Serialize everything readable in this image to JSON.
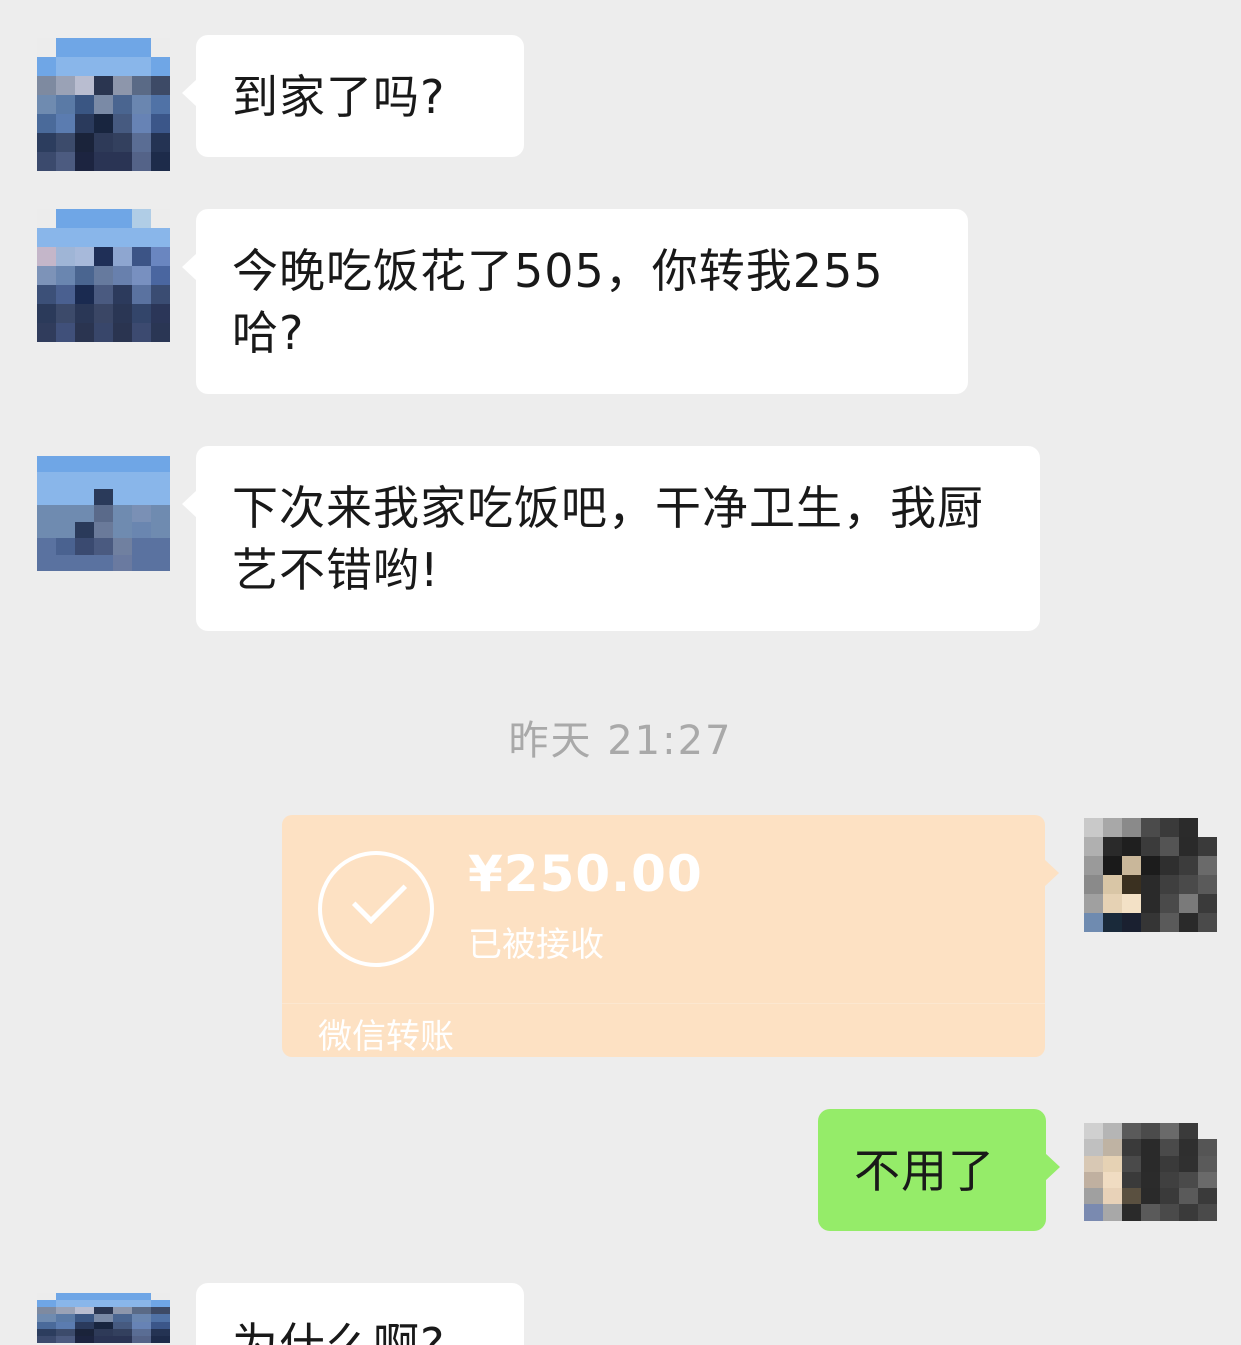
{
  "messages": [
    {
      "side": "left",
      "text": "到家了吗?"
    },
    {
      "side": "left",
      "text": "今晚吃饭花了505，你转我255哈?"
    },
    {
      "side": "left",
      "text": "下次来我家吃饭吧，干净卫生，我厨艺不错哟!"
    }
  ],
  "timestamp": "昨天 21:27",
  "transfer": {
    "amount": "¥250.00",
    "status": "已被接收",
    "footer": "微信转账"
  },
  "reply": {
    "side": "right",
    "text": "不用了"
  },
  "last_message": {
    "side": "left",
    "text": "为什么啊?"
  },
  "colors": {
    "background": "#ededed",
    "bubble_left": "#ffffff",
    "bubble_right": "#95ec69",
    "transfer_card": "#fde1c3",
    "timestamp": "#a9a9a9"
  },
  "icons": {
    "transfer_status": "check-circle-icon"
  }
}
